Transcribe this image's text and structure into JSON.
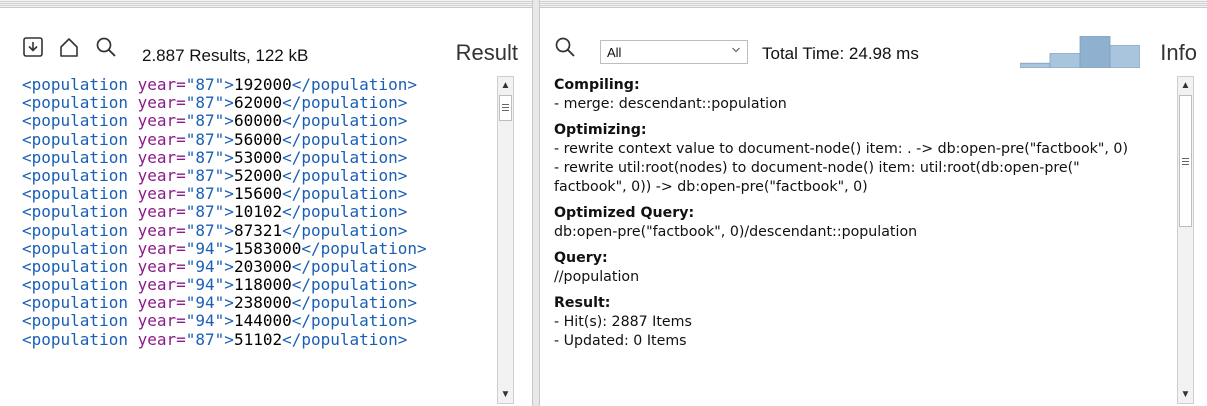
{
  "results": {
    "summary": "2.887 Results, 122 kB",
    "title": "Result",
    "lines": [
      {
        "tag": "population",
        "attr": "year",
        "year": "87",
        "value": "192000"
      },
      {
        "tag": "population",
        "attr": "year",
        "year": "87",
        "value": "62000"
      },
      {
        "tag": "population",
        "attr": "year",
        "year": "87",
        "value": "60000"
      },
      {
        "tag": "population",
        "attr": "year",
        "year": "87",
        "value": "56000"
      },
      {
        "tag": "population",
        "attr": "year",
        "year": "87",
        "value": "53000"
      },
      {
        "tag": "population",
        "attr": "year",
        "year": "87",
        "value": "52000"
      },
      {
        "tag": "population",
        "attr": "year",
        "year": "87",
        "value": "15600"
      },
      {
        "tag": "population",
        "attr": "year",
        "year": "87",
        "value": "10102"
      },
      {
        "tag": "population",
        "attr": "year",
        "year": "87",
        "value": "87321"
      },
      {
        "tag": "population",
        "attr": "year",
        "year": "94",
        "value": "1583000"
      },
      {
        "tag": "population",
        "attr": "year",
        "year": "94",
        "value": "203000"
      },
      {
        "tag": "population",
        "attr": "year",
        "year": "94",
        "value": "118000"
      },
      {
        "tag": "population",
        "attr": "year",
        "year": "94",
        "value": "238000"
      },
      {
        "tag": "population",
        "attr": "year",
        "year": "94",
        "value": "144000"
      },
      {
        "tag": "population",
        "attr": "year",
        "year": "87",
        "value": "51102"
      }
    ],
    "icons": [
      "save-icon",
      "home-icon",
      "search-icon"
    ]
  },
  "info": {
    "title": "Info",
    "filter_value": "All",
    "total_time": "Total Time: 24.98 ms",
    "timing_bars": [
      0.15,
      0.45,
      1.0,
      0.7
    ],
    "sections": [
      {
        "heading": "Compiling:",
        "lines": [
          "- merge: descendant::population"
        ]
      },
      {
        "heading": "Optimizing:",
        "lines": [
          "- rewrite context value to document-node() item: . -> db:open-pre(\"factbook\", 0)",
          "- rewrite util:root(nodes) to document-node() item: util:root(db:open-pre(\"",
          "factbook\", 0)) -> db:open-pre(\"factbook\", 0)"
        ]
      },
      {
        "heading": "Optimized Query:",
        "lines": [
          "db:open-pre(\"factbook\", 0)/descendant::population"
        ]
      },
      {
        "heading": "Query:",
        "lines": [
          "//population"
        ]
      },
      {
        "heading": "Result:",
        "lines": [
          "- Hit(s): 2887 Items",
          "- Updated: 0 Items"
        ]
      }
    ]
  },
  "colors": {
    "tag": "#1a5fb4",
    "attribute": "#8b1a8b",
    "chart_bar": "#a9c4dd",
    "chart_bar_dark": "#8fb0cf"
  }
}
